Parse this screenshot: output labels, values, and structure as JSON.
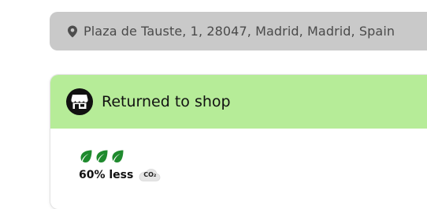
{
  "address": {
    "icon": "location-pin-icon",
    "text": "Plaza de Tauste, 1, 28047, Madrid, Madrid, Spain"
  },
  "status": {
    "icon": "shop-icon",
    "title": "Returned to shop",
    "header_color": "#b6ec98"
  },
  "eco": {
    "leaf_count": 3,
    "leaf_color": "#1f8a2e",
    "label": "60% less",
    "co2_icon_label": "CO₂"
  }
}
